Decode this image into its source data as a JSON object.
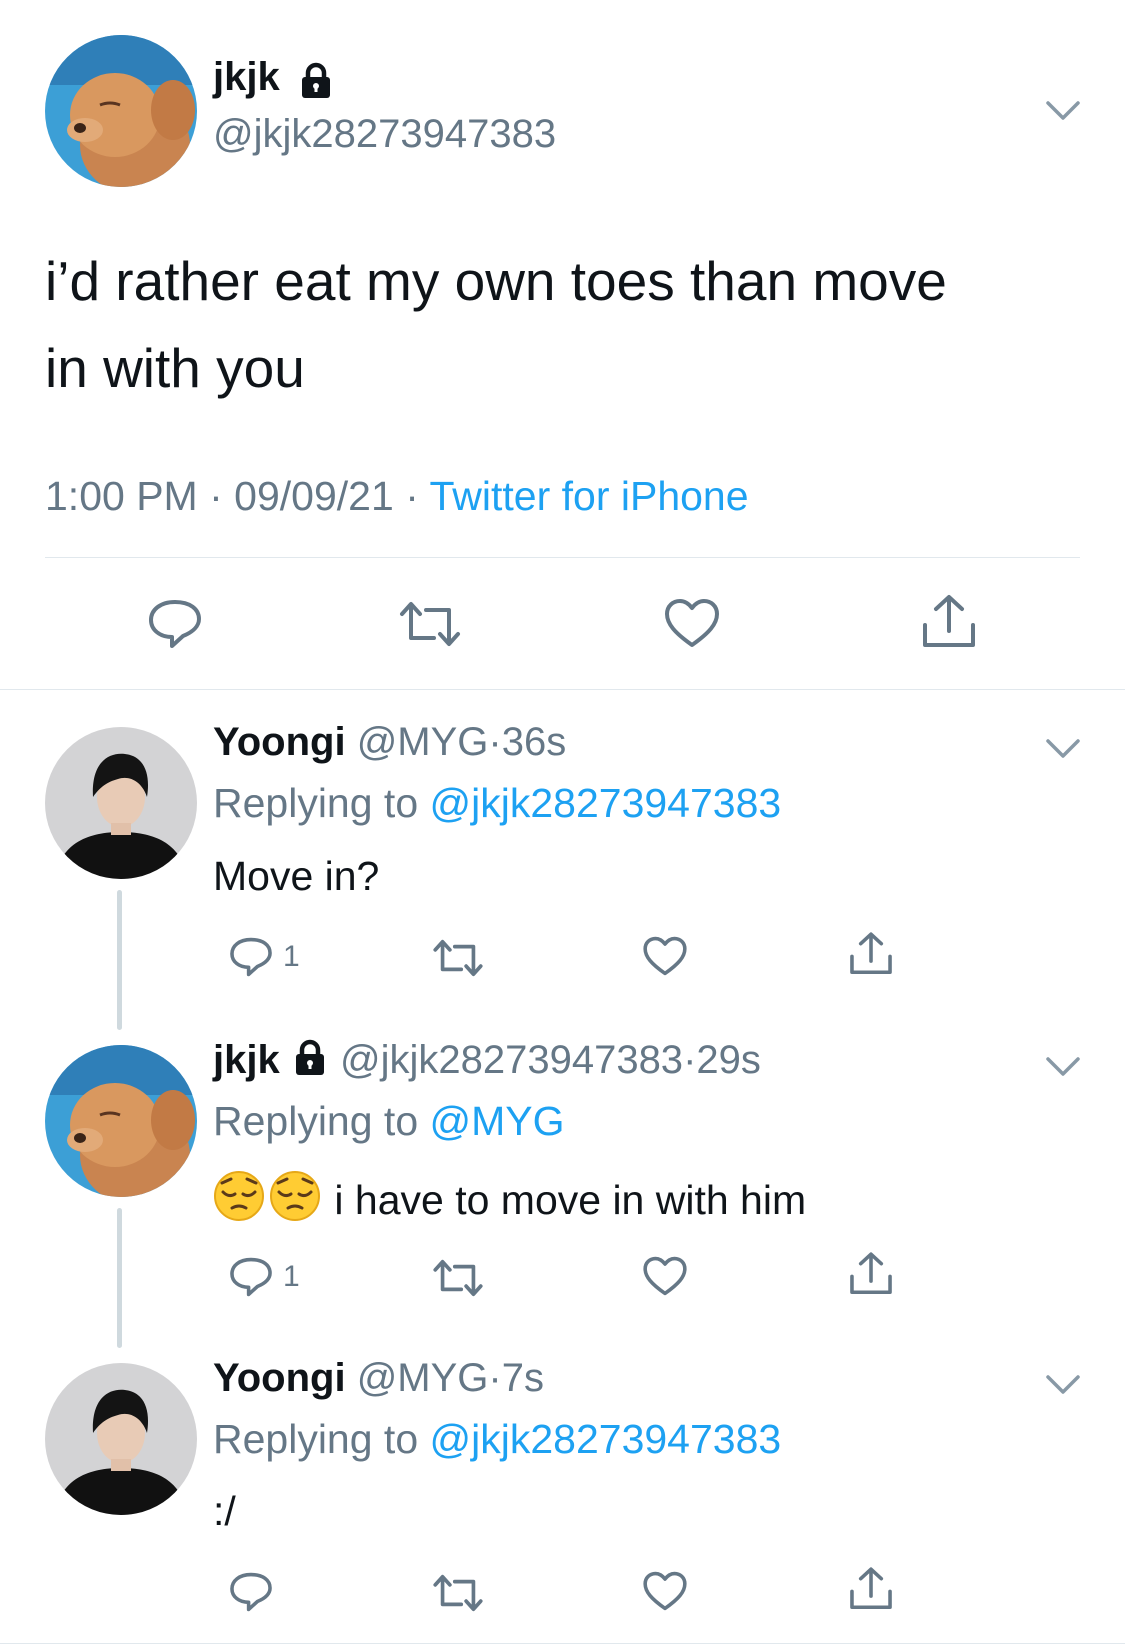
{
  "main_tweet": {
    "name": "jkjk",
    "handle": "@jkjk28273947383",
    "text_line1": "i’d rather eat my own toes than move",
    "text_line2": "in with you",
    "time": "1:00 PM",
    "date": "09/09/21",
    "source": "Twitter for iPhone",
    "sep": "·"
  },
  "replies": [
    {
      "name": "Yoongi",
      "handle": "@MYG",
      "age": "36s",
      "replying_label": "Replying to",
      "replying_to": "@jkjk28273947383",
      "text": "Move in?",
      "reply_count": "1"
    },
    {
      "name": "jkjk",
      "handle": "@jkjk28273947383",
      "age": "29s",
      "replying_label": "Replying to",
      "replying_to": "@MYG",
      "emoji": "😔😔",
      "text": "i have to move in with him",
      "reply_count": "1"
    },
    {
      "name": "Yoongi",
      "handle": "@MYG",
      "age": "7s",
      "replying_label": "Replying to",
      "replying_to": "@jkjk28273947383",
      "text": ":/"
    }
  ],
  "colors": {
    "accent": "#1da1f2",
    "secondary": "#657786",
    "thread_line": "#cfd9de"
  }
}
